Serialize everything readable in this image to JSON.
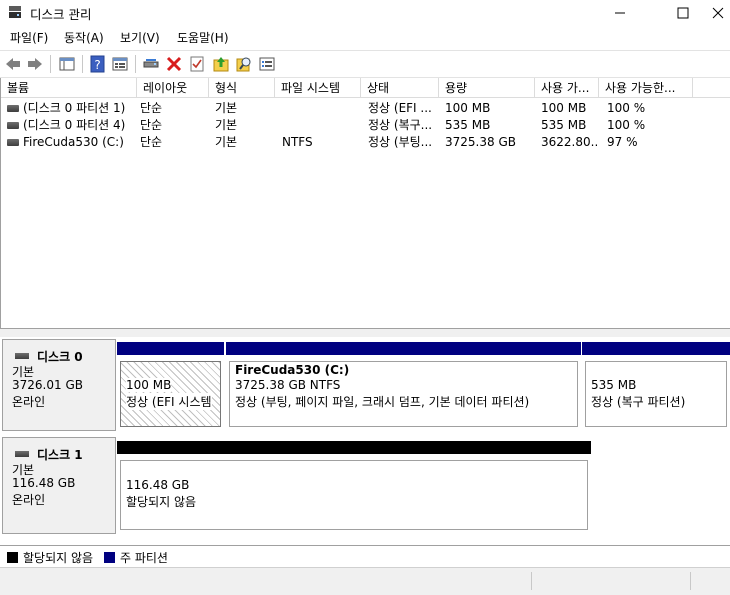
{
  "window": {
    "title": "디스크 관리",
    "minimize_glyph": "—",
    "maximize_glyph": "☐",
    "close_glyph": "✕"
  },
  "menu": [
    "파일(F)",
    "동작(A)",
    "보기(V)",
    "도움말(H)"
  ],
  "toolbar": {
    "icons": [
      "back-icon",
      "forward-icon",
      "console-tree-icon",
      "help-icon",
      "properties-icon",
      "connect-icon",
      "delete-icon",
      "check-icon",
      "upload-icon",
      "search-icon",
      "settings-icon"
    ]
  },
  "columns": [
    "볼륨",
    "레이아웃",
    "형식",
    "파일 시스템",
    "상태",
    "용량",
    "사용 가...",
    "사용 가능한..."
  ],
  "volumes": [
    {
      "name": "(디스크 0 파티션 1)",
      "layout": "단순",
      "type": "기본",
      "fs": "",
      "status": "정상 (EFI ...",
      "capacity": "100 MB",
      "free": "100 MB",
      "pct": "100 %"
    },
    {
      "name": "(디스크 0 파티션 4)",
      "layout": "단순",
      "type": "기본",
      "fs": "",
      "status": "정상 (복구...",
      "capacity": "535 MB",
      "free": "535 MB",
      "pct": "100 %"
    },
    {
      "name": "FireCuda530 (C:)",
      "layout": "단순",
      "type": "기본",
      "fs": "NTFS",
      "status": "정상 (부팅...",
      "capacity": "3725.38 GB",
      "free": "3622.80...",
      "pct": "97 %"
    }
  ],
  "disks": [
    {
      "name": "디스크 0",
      "kind": "기본",
      "size": "3726.01 GB",
      "state": "온라인",
      "partitions": [
        {
          "title": "",
          "line1": "100 MB",
          "line2": "정상 (EFI 시스템"
        },
        {
          "title": "FireCuda530  (C:)",
          "line1": "3725.38 GB NTFS",
          "line2": "정상 (부팅, 페이지 파일, 크래시 덤프, 기본 데이터 파티션)"
        },
        {
          "title": "",
          "line1": "535 MB",
          "line2": "정상 (복구 파티션)"
        }
      ]
    },
    {
      "name": "디스크 1",
      "kind": "기본",
      "size": "116.48 GB",
      "state": "온라인",
      "partitions": [
        {
          "title": "",
          "line1": "116.48 GB",
          "line2": "할당되지 않음"
        }
      ]
    }
  ],
  "legend": [
    {
      "label": "할당되지 않음",
      "color": "#000000"
    },
    {
      "label": "주 파티션",
      "color": "#000080"
    }
  ],
  "colors": {
    "primary_partition": "#000080",
    "unallocated": "#000000",
    "selection_border": "#a0a0a0"
  }
}
